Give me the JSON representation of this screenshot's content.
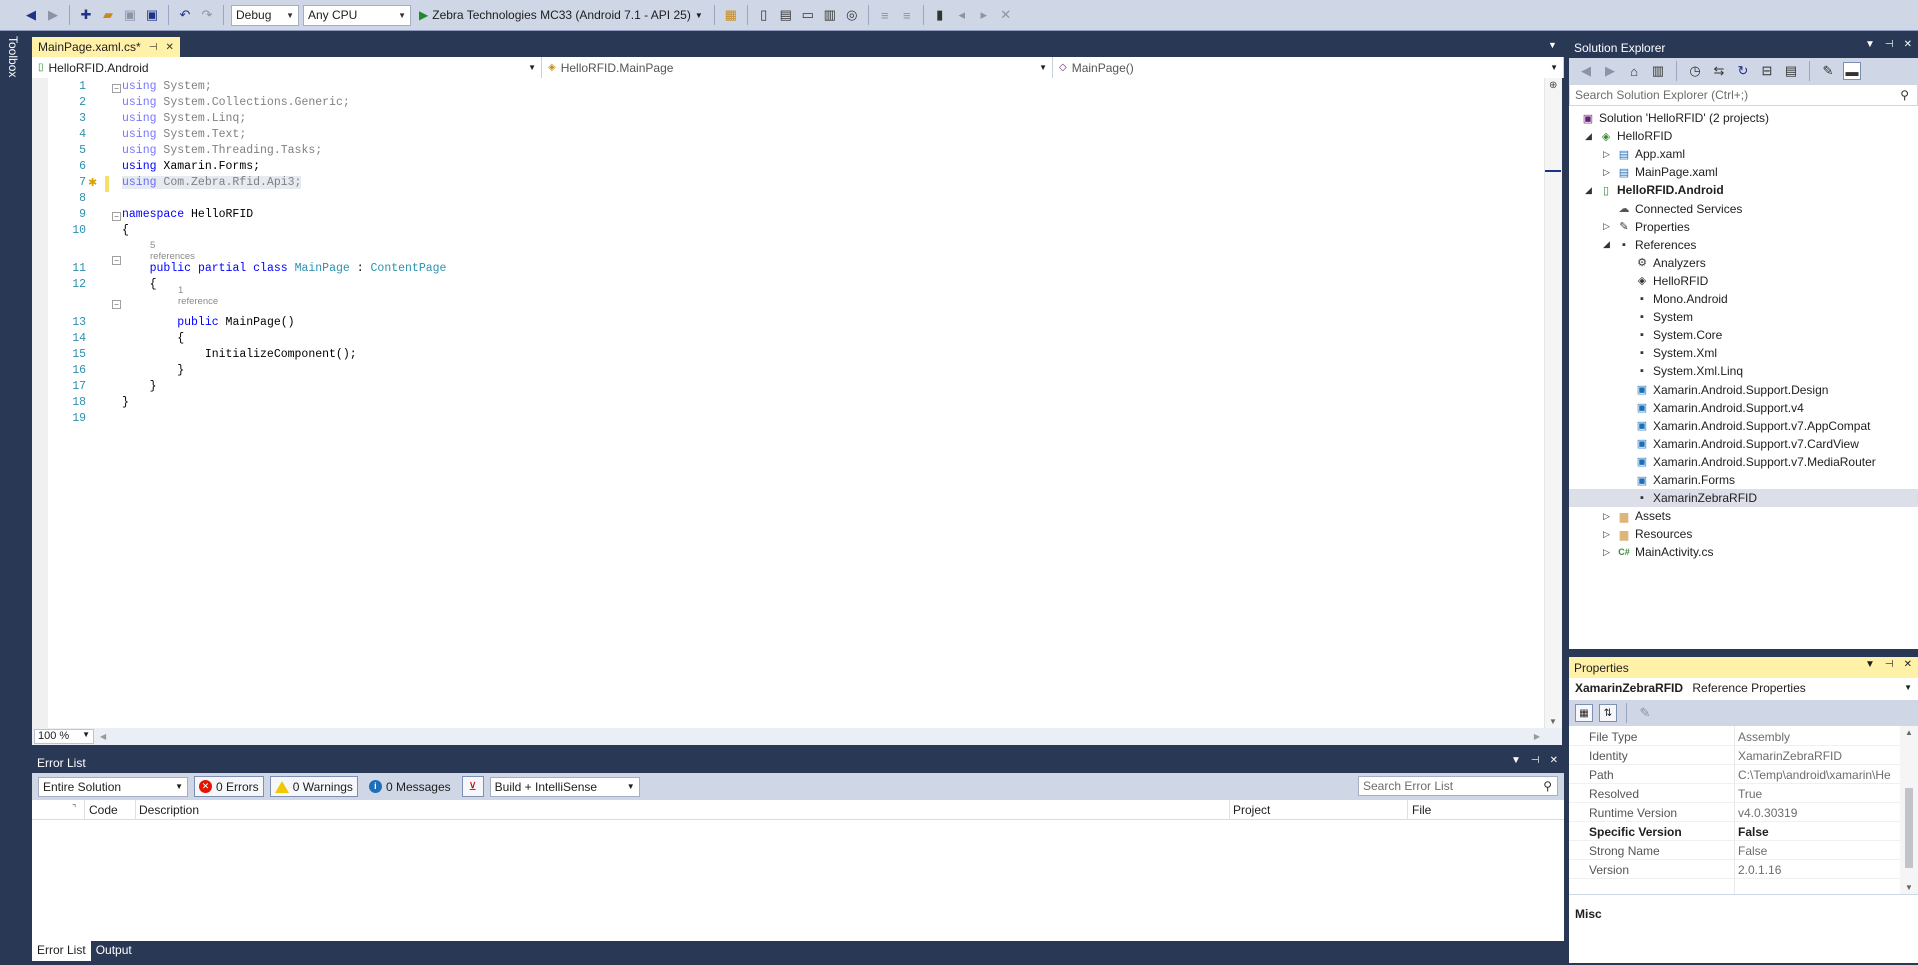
{
  "toolbar": {
    "config": "Debug",
    "platform": "Any CPU",
    "run_target": "Zebra Technologies MC33 (Android 7.1 - API 25)"
  },
  "toolbox_label": "Toolbox",
  "editor": {
    "tab_title": "MainPage.xaml.cs*",
    "nav_project": "HelloRFID.Android",
    "nav_type": "HelloRFID.MainPage",
    "nav_member": "MainPage()",
    "zoom": "100 %",
    "lines": [
      {
        "num": "1",
        "parts": [
          {
            "t": "using",
            "c": "kw-dim"
          },
          {
            "t": " System;",
            "c": "dim"
          }
        ]
      },
      {
        "num": "2",
        "parts": [
          {
            "t": "using",
            "c": "kw-dim"
          },
          {
            "t": " System.Collections.Generic;",
            "c": "dim"
          }
        ]
      },
      {
        "num": "3",
        "parts": [
          {
            "t": "using",
            "c": "kw-dim"
          },
          {
            "t": " System.Linq;",
            "c": "dim"
          }
        ]
      },
      {
        "num": "4",
        "parts": [
          {
            "t": "using",
            "c": "kw-dim"
          },
          {
            "t": " System.Text;",
            "c": "dim"
          }
        ]
      },
      {
        "num": "5",
        "parts": [
          {
            "t": "using",
            "c": "kw-dim"
          },
          {
            "t": " System.Threading.Tasks;",
            "c": "dim"
          }
        ]
      },
      {
        "num": "6",
        "parts": [
          {
            "t": "using",
            "c": "kw"
          },
          {
            "t": " Xamarin.Forms;",
            "c": ""
          }
        ]
      },
      {
        "num": "7",
        "parts": [
          {
            "t": "using",
            "c": "kw-dim"
          },
          {
            "t": " Com.Zebra.Rfid.Api3;",
            "c": "dim"
          }
        ]
      },
      {
        "num": "8",
        "parts": []
      },
      {
        "num": "9",
        "parts": [
          {
            "t": "namespace",
            "c": "kw"
          },
          {
            "t": " HelloRFID",
            "c": ""
          }
        ]
      },
      {
        "num": "10",
        "parts": [
          {
            "t": "{",
            "c": ""
          }
        ]
      },
      {
        "num": "11",
        "parts": [
          {
            "t": "    ",
            "c": ""
          },
          {
            "t": "public",
            "c": "kw"
          },
          {
            "t": " ",
            "c": ""
          },
          {
            "t": "partial",
            "c": "kw"
          },
          {
            "t": " ",
            "c": ""
          },
          {
            "t": "class",
            "c": "kw"
          },
          {
            "t": " ",
            "c": ""
          },
          {
            "t": "MainPage",
            "c": "ty"
          },
          {
            "t": " : ",
            "c": ""
          },
          {
            "t": "ContentPage",
            "c": "ty"
          }
        ]
      },
      {
        "num": "12",
        "parts": [
          {
            "t": "    {",
            "c": ""
          }
        ]
      },
      {
        "num": "13",
        "parts": [
          {
            "t": "        ",
            "c": ""
          },
          {
            "t": "public",
            "c": "kw"
          },
          {
            "t": " MainPage()",
            "c": ""
          }
        ]
      },
      {
        "num": "14",
        "parts": [
          {
            "t": "        {",
            "c": ""
          }
        ]
      },
      {
        "num": "15",
        "parts": [
          {
            "t": "            InitializeComponent();",
            "c": ""
          }
        ]
      },
      {
        "num": "16",
        "parts": [
          {
            "t": "        }",
            "c": ""
          }
        ]
      },
      {
        "num": "17",
        "parts": [
          {
            "t": "    }",
            "c": ""
          }
        ]
      },
      {
        "num": "18",
        "parts": [
          {
            "t": "}",
            "c": ""
          }
        ]
      },
      {
        "num": "19",
        "parts": []
      }
    ],
    "ref_hint_class": "5 references",
    "ref_hint_ctor": "1 reference"
  },
  "error_list": {
    "title": "Error List",
    "scope": "Entire Solution",
    "errors": "0 Errors",
    "warnings": "0 Warnings",
    "messages": "0 Messages",
    "source": "Build + IntelliSense",
    "search_placeholder": "Search Error List",
    "columns": [
      "Code",
      "Description",
      "Project",
      "File"
    ],
    "tabs": [
      "Error List",
      "Output"
    ]
  },
  "solution_explorer": {
    "title": "Solution Explorer",
    "search_placeholder": "Search Solution Explorer (Ctrl+;)",
    "items": [
      {
        "label": "Solution 'HelloRFID' (2 projects)",
        "level": 0,
        "exp": "",
        "icon": "solution-icon",
        "glyph": "▣",
        "color": "#68217a"
      },
      {
        "label": "HelloRFID",
        "level": 1,
        "exp": "◢",
        "icon": "shared-project-icon",
        "glyph": "◈",
        "color": "#388a34"
      },
      {
        "label": "App.xaml",
        "level": 2,
        "exp": "▷",
        "icon": "xaml-file-icon",
        "glyph": "▤",
        "color": "#1e6fb8"
      },
      {
        "label": "MainPage.xaml",
        "level": 2,
        "exp": "▷",
        "icon": "xaml-file-icon",
        "glyph": "▤",
        "color": "#1e6fb8"
      },
      {
        "label": "HelloRFID.Android",
        "level": 1,
        "exp": "◢",
        "icon": "android-project-icon",
        "glyph": "▯",
        "color": "#388a34",
        "bold": true
      },
      {
        "label": "Connected Services",
        "level": 2,
        "exp": "",
        "icon": "connected-services-icon",
        "glyph": "☁",
        "color": "#555555"
      },
      {
        "label": "Properties",
        "level": 2,
        "exp": "▷",
        "icon": "wrench-icon",
        "glyph": "✎",
        "color": "#333333"
      },
      {
        "label": "References",
        "level": 2,
        "exp": "◢",
        "icon": "references-icon",
        "glyph": "▪",
        "color": "#333333"
      },
      {
        "label": "Analyzers",
        "level": 3,
        "exp": "",
        "icon": "analyzers-icon",
        "glyph": "⚙",
        "color": "#333333"
      },
      {
        "label": "HelloRFID",
        "level": 3,
        "exp": "",
        "icon": "project-ref-icon",
        "glyph": "◈",
        "color": "#333333"
      },
      {
        "label": "Mono.Android",
        "level": 3,
        "exp": "",
        "icon": "assembly-ref-icon",
        "glyph": "▪",
        "color": "#333333"
      },
      {
        "label": "System",
        "level": 3,
        "exp": "",
        "icon": "assembly-ref-icon",
        "glyph": "▪",
        "color": "#333333"
      },
      {
        "label": "System.Core",
        "level": 3,
        "exp": "",
        "icon": "assembly-ref-icon",
        "glyph": "▪",
        "color": "#333333"
      },
      {
        "label": "System.Xml",
        "level": 3,
        "exp": "",
        "icon": "assembly-ref-icon",
        "glyph": "▪",
        "color": "#333333"
      },
      {
        "label": "System.Xml.Linq",
        "level": 3,
        "exp": "",
        "icon": "assembly-ref-icon",
        "glyph": "▪",
        "color": "#333333"
      },
      {
        "label": "Xamarin.Android.Support.Design",
        "level": 3,
        "exp": "",
        "icon": "package-ref-icon",
        "glyph": "▣",
        "color": "#1e6fb8"
      },
      {
        "label": "Xamarin.Android.Support.v4",
        "level": 3,
        "exp": "",
        "icon": "package-ref-icon",
        "glyph": "▣",
        "color": "#1e6fb8"
      },
      {
        "label": "Xamarin.Android.Support.v7.AppCompat",
        "level": 3,
        "exp": "",
        "icon": "package-ref-icon",
        "glyph": "▣",
        "color": "#1e6fb8"
      },
      {
        "label": "Xamarin.Android.Support.v7.CardView",
        "level": 3,
        "exp": "",
        "icon": "package-ref-icon",
        "glyph": "▣",
        "color": "#1e6fb8"
      },
      {
        "label": "Xamarin.Android.Support.v7.MediaRouter",
        "level": 3,
        "exp": "",
        "icon": "package-ref-icon",
        "glyph": "▣",
        "color": "#1e6fb8"
      },
      {
        "label": "Xamarin.Forms",
        "level": 3,
        "exp": "",
        "icon": "package-ref-icon",
        "glyph": "▣",
        "color": "#1e6fb8"
      },
      {
        "label": "XamarinZebraRFID",
        "level": 3,
        "exp": "",
        "icon": "assembly-ref-icon",
        "glyph": "▪",
        "color": "#333333",
        "selected": true
      },
      {
        "label": "Assets",
        "level": 2,
        "exp": "▷",
        "icon": "folder-icon",
        "glyph": "▆",
        "color": "#dcb67a"
      },
      {
        "label": "Resources",
        "level": 2,
        "exp": "▷",
        "icon": "folder-icon",
        "glyph": "▆",
        "color": "#dcb67a"
      },
      {
        "label": "MainActivity.cs",
        "level": 2,
        "exp": "▷",
        "icon": "csharp-file-icon",
        "glyph": "C#",
        "color": "#388a34"
      }
    ]
  },
  "properties": {
    "title": "Properties",
    "object_name": "XamarinZebraRFID",
    "object_type": "Reference Properties",
    "rows": [
      {
        "name": "File Type",
        "value": "Assembly",
        "bold": false
      },
      {
        "name": "Identity",
        "value": "XamarinZebraRFID",
        "bold": false
      },
      {
        "name": "Path",
        "value": "C:\\Temp\\android\\xamarin\\He",
        "bold": false
      },
      {
        "name": "Resolved",
        "value": "True",
        "bold": false
      },
      {
        "name": "Runtime Version",
        "value": "v4.0.30319",
        "bold": false
      },
      {
        "name": "Specific Version",
        "value": "False",
        "bold": true
      },
      {
        "name": "Strong Name",
        "value": "False",
        "bold": false
      },
      {
        "name": "Version",
        "value": "2.0.1.16",
        "bold": false
      }
    ],
    "description_heading": "Misc"
  }
}
